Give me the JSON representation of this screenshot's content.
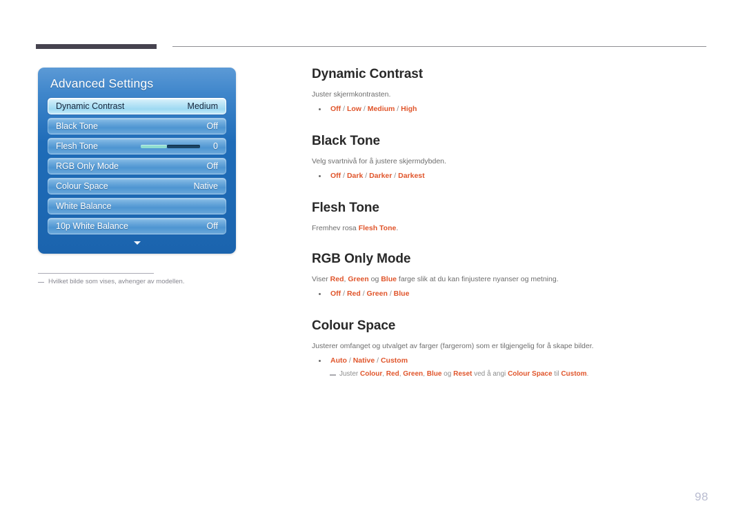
{
  "page": {
    "number": "98"
  },
  "osd": {
    "title": "Advanced Settings",
    "more_icon": "chevron-down-icon",
    "rows": [
      {
        "label": "Dynamic Contrast",
        "value": "Medium",
        "selected": true,
        "type": "value"
      },
      {
        "label": "Black Tone",
        "value": "Off",
        "selected": false,
        "type": "value"
      },
      {
        "label": "Flesh Tone",
        "value": "0",
        "selected": false,
        "type": "slider"
      },
      {
        "label": "RGB Only Mode",
        "value": "Off",
        "selected": false,
        "type": "value"
      },
      {
        "label": "Colour Space",
        "value": "Native",
        "selected": false,
        "type": "value"
      },
      {
        "label": "White Balance",
        "value": "",
        "selected": false,
        "type": "none"
      },
      {
        "label": "10p White Balance",
        "value": "Off",
        "selected": false,
        "type": "value"
      }
    ]
  },
  "footnote": {
    "text": "Hvilket bilde som vises, avhenger av modellen."
  },
  "sections": [
    {
      "heading": "Dynamic Contrast",
      "description": "Juster skjermkontrasten.",
      "options": [
        "Off",
        "Low",
        "Medium",
        "High"
      ]
    },
    {
      "heading": "Black Tone",
      "description": "Velg svartnivå for å justere skjermdybden.",
      "options": [
        "Off",
        "Dark",
        "Darker",
        "Darkest"
      ]
    },
    {
      "heading": "Flesh Tone",
      "description_pre": "Fremhev rosa ",
      "description_accent": "Flesh Tone",
      "description_post": ".",
      "options": []
    },
    {
      "heading": "RGB Only Mode",
      "options": [
        "Off",
        "Red",
        "Green",
        "Blue"
      ]
    },
    {
      "heading": "Colour Space",
      "description": "Justerer omfanget og utvalget av farger (fargerom) som er tilgjengelig for å skape bilder.",
      "options": [
        "Auto",
        "Native",
        "Custom"
      ]
    }
  ],
  "rgb_desc": {
    "t1": "Viser ",
    "a1": "Red",
    "t2": ", ",
    "a2": "Green",
    "t3": " og ",
    "a3": "Blue",
    "t4": " farge slik at du kan finjustere nyanser og metning."
  },
  "colour_space_note": {
    "t1": "Juster ",
    "a1": "Colour",
    "t2": ", ",
    "a2": "Red",
    "t3": ", ",
    "a3": "Green",
    "t4": ", ",
    "a4": "Blue",
    "t5": " og ",
    "a5": "Reset",
    "t6": " ved å angi ",
    "a6": "Colour Space",
    "t7": " til ",
    "a7": "Custom",
    "t8": "."
  },
  "colors": {
    "accent": "#e0552b",
    "heading": "#292929",
    "body": "#6d6d6d",
    "panel_blue": "#1f6cb8",
    "rule_dark": "#46434f",
    "page_number": "#b9bcd0"
  }
}
